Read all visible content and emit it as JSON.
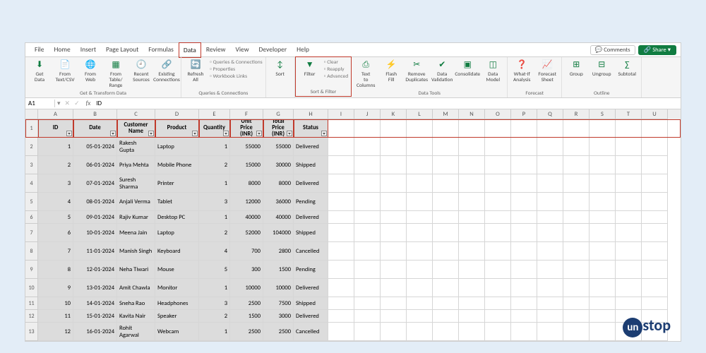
{
  "menu": {
    "items": [
      "File",
      "Home",
      "Insert",
      "Page Layout",
      "Formulas",
      "Data",
      "Review",
      "View",
      "Developer",
      "Help"
    ],
    "active_index": 5,
    "comments": "Comments",
    "share": "Share"
  },
  "ribbon": {
    "groups": [
      {
        "label": "Get & Transform Data",
        "buttons": [
          "Get Data",
          "From Text/CSV",
          "From Web",
          "From Table/ Range",
          "Recent Sources",
          "Existing Connections"
        ]
      },
      {
        "label": "Queries & Connections",
        "primary": "Refresh All",
        "stack": [
          "Queries & Connections",
          "Properties",
          "Workbook Links"
        ]
      },
      {
        "label": "",
        "buttons": [
          "Sort"
        ],
        "hidden_label": "Sort"
      },
      {
        "label": "Sort & Filter",
        "primary": "Filter",
        "stack": [
          "Clear",
          "Reapply",
          "Advanced"
        ],
        "highlighted": true
      },
      {
        "label": "Data Tools",
        "buttons": [
          "Text to Columns",
          "Flash Fill",
          "Remove Duplicates",
          "Data Validation",
          "Consolidate",
          "Data Model"
        ]
      },
      {
        "label": "Forecast",
        "buttons": [
          "What-If Analysis",
          "Forecast Sheet"
        ]
      },
      {
        "label": "Outline",
        "buttons": [
          "Group",
          "Ungroup",
          "Subtotal"
        ]
      }
    ]
  },
  "formula_bar": {
    "name_box": "A1",
    "fx": "fx",
    "value": "ID"
  },
  "columns": [
    "A",
    "B",
    "C",
    "D",
    "E",
    "F",
    "G",
    "H",
    "I",
    "J",
    "K",
    "L",
    "M",
    "N",
    "O",
    "P",
    "Q",
    "R",
    "S",
    "T",
    "U"
  ],
  "headers": [
    "ID",
    "Date",
    "Customer Name",
    "Product",
    "Quantity",
    "Unit Price (INR)",
    "Total Price (INR)",
    "Status"
  ],
  "rows": [
    {
      "n": 2,
      "id": 1,
      "date": "05-01-2024",
      "name": "Rakesh Gupta",
      "product": "Laptop",
      "qty": 1,
      "unit": 55000,
      "total": 55000,
      "status": "Delivered"
    },
    {
      "n": 3,
      "id": 2,
      "date": "06-01-2024",
      "name": "Priya Mehta",
      "product": "Mobile Phone",
      "qty": 2,
      "unit": 15000,
      "total": 30000,
      "status": "Shipped"
    },
    {
      "n": 4,
      "id": 3,
      "date": "07-01-2024",
      "name": "Suresh Sharma",
      "product": "Printer",
      "qty": 1,
      "unit": 8000,
      "total": 8000,
      "status": "Delivered"
    },
    {
      "n": 5,
      "id": 4,
      "date": "08-01-2024",
      "name": "Anjali Verma",
      "product": "Tablet",
      "qty": 3,
      "unit": 12000,
      "total": 36000,
      "status": "Pending"
    },
    {
      "n": 6,
      "id": 5,
      "date": "09-01-2024",
      "name": "Rajiv Kumar",
      "product": "Desktop PC",
      "qty": 1,
      "unit": 40000,
      "total": 40000,
      "status": "Delivered"
    },
    {
      "n": 7,
      "id": 6,
      "date": "10-01-2024",
      "name": "Meena Jain",
      "product": "Laptop",
      "qty": 2,
      "unit": 52000,
      "total": 104000,
      "status": "Shipped"
    },
    {
      "n": 8,
      "id": 7,
      "date": "11-01-2024",
      "name": "Manish Singh",
      "product": "Keyboard",
      "qty": 4,
      "unit": 700,
      "total": 2800,
      "status": "Cancelled"
    },
    {
      "n": 9,
      "id": 8,
      "date": "12-01-2024",
      "name": "Neha Tiwari",
      "product": "Mouse",
      "qty": 5,
      "unit": 300,
      "total": 1500,
      "status": "Pending"
    },
    {
      "n": 10,
      "id": 9,
      "date": "13-01-2024",
      "name": "Amit Chawla",
      "product": "Monitor",
      "qty": 1,
      "unit": 10000,
      "total": 10000,
      "status": "Delivered"
    },
    {
      "n": 11,
      "id": 10,
      "date": "14-01-2024",
      "name": "Sneha Rao",
      "product": "Headphones",
      "qty": 3,
      "unit": 2500,
      "total": 7500,
      "status": "Shipped"
    },
    {
      "n": 12,
      "id": 11,
      "date": "15-01-2024",
      "name": "Kavita Nair",
      "product": "Speaker",
      "qty": 2,
      "unit": 1500,
      "total": 3000,
      "status": "Delivered"
    },
    {
      "n": 13,
      "id": 12,
      "date": "16-01-2024",
      "name": "Rohit Agarwal",
      "product": "Webcam",
      "qty": 1,
      "unit": 2500,
      "total": 2500,
      "status": "Cancelled"
    }
  ],
  "logo": {
    "text": "stop",
    "circle": "un"
  }
}
